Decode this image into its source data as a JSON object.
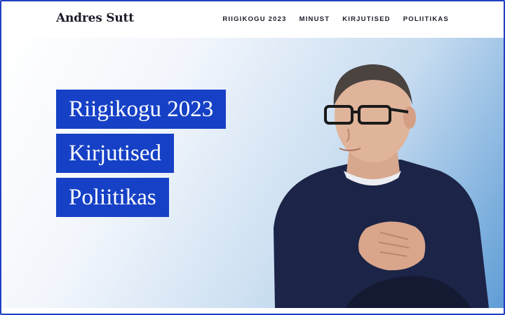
{
  "header": {
    "site_title": "Andres Sutt",
    "nav": [
      "RIIGIKOGU 2023",
      "MINUST",
      "KIRJUTISED",
      "POLIITIKAS"
    ]
  },
  "hero": {
    "links": [
      "Riigikogu 2023",
      "Kirjutised",
      "Poliitikas"
    ]
  },
  "colors": {
    "accent": "#1641c6",
    "frame": "#1e40c0",
    "text": "#1c1c2a",
    "sweater": "#1c2447"
  }
}
